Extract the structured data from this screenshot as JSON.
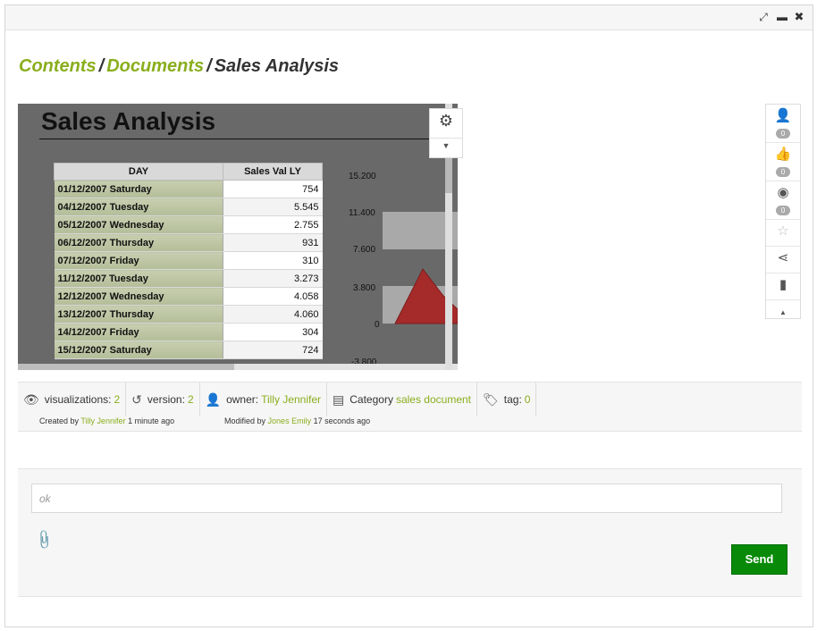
{
  "window": {
    "expand_icon": "⤢",
    "minimize_icon": "▬",
    "close_icon": "✖"
  },
  "breadcrumb": {
    "items": [
      "Contents",
      "Documents"
    ],
    "current": "Sales Analysis",
    "separator": "/"
  },
  "report": {
    "title": "Sales Analysis",
    "columns": [
      "DAY",
      "Sales Val LY"
    ],
    "rows": [
      {
        "day": "01/12/2007 Saturday",
        "value": "754"
      },
      {
        "day": "04/12/2007 Tuesday",
        "value": "5.545"
      },
      {
        "day": "05/12/2007 Wednesday",
        "value": "2.755"
      },
      {
        "day": "06/12/2007 Thursday",
        "value": "931"
      },
      {
        "day": "07/12/2007 Friday",
        "value": "310"
      },
      {
        "day": "11/12/2007 Tuesday",
        "value": "3.273"
      },
      {
        "day": "12/12/2007 Wednesday",
        "value": "4.058"
      },
      {
        "day": "13/12/2007 Thursday",
        "value": "4.060"
      },
      {
        "day": "14/12/2007 Friday",
        "value": "304"
      },
      {
        "day": "15/12/2007 Saturday",
        "value": "724"
      }
    ],
    "chart_axis": [
      "15.200",
      "11.400",
      "7.600",
      "3.800",
      "0",
      "-3.800"
    ]
  },
  "actions": {
    "users": {
      "icon": "user-icon",
      "count": "0"
    },
    "likes": {
      "icon": "thumbs-up-icon",
      "count": "0"
    },
    "broadcast": {
      "icon": "broadcast-icon",
      "count": "0"
    }
  },
  "meta": {
    "visualizations_label": "visualizations:",
    "visualizations_value": "2",
    "version_label": "version:",
    "version_value": "2",
    "owner_label": "owner:",
    "owner_value": "Tilly Jennifer",
    "category_label": "Category",
    "category_value": "sales document",
    "tag_label": "tag:",
    "tag_value": "0",
    "created_prefix": "Created by",
    "created_by": "Tilly Jennifer",
    "created_when": "1 minute ago",
    "modified_prefix": "Modified by",
    "modified_by": "Jones Emily",
    "modified_when": "17 seconds ago"
  },
  "comment": {
    "value": "ok",
    "send_label": "Send"
  },
  "colors": {
    "accent": "#8aae1d",
    "send": "#088a08",
    "chart_fill": "#a52a2a"
  }
}
